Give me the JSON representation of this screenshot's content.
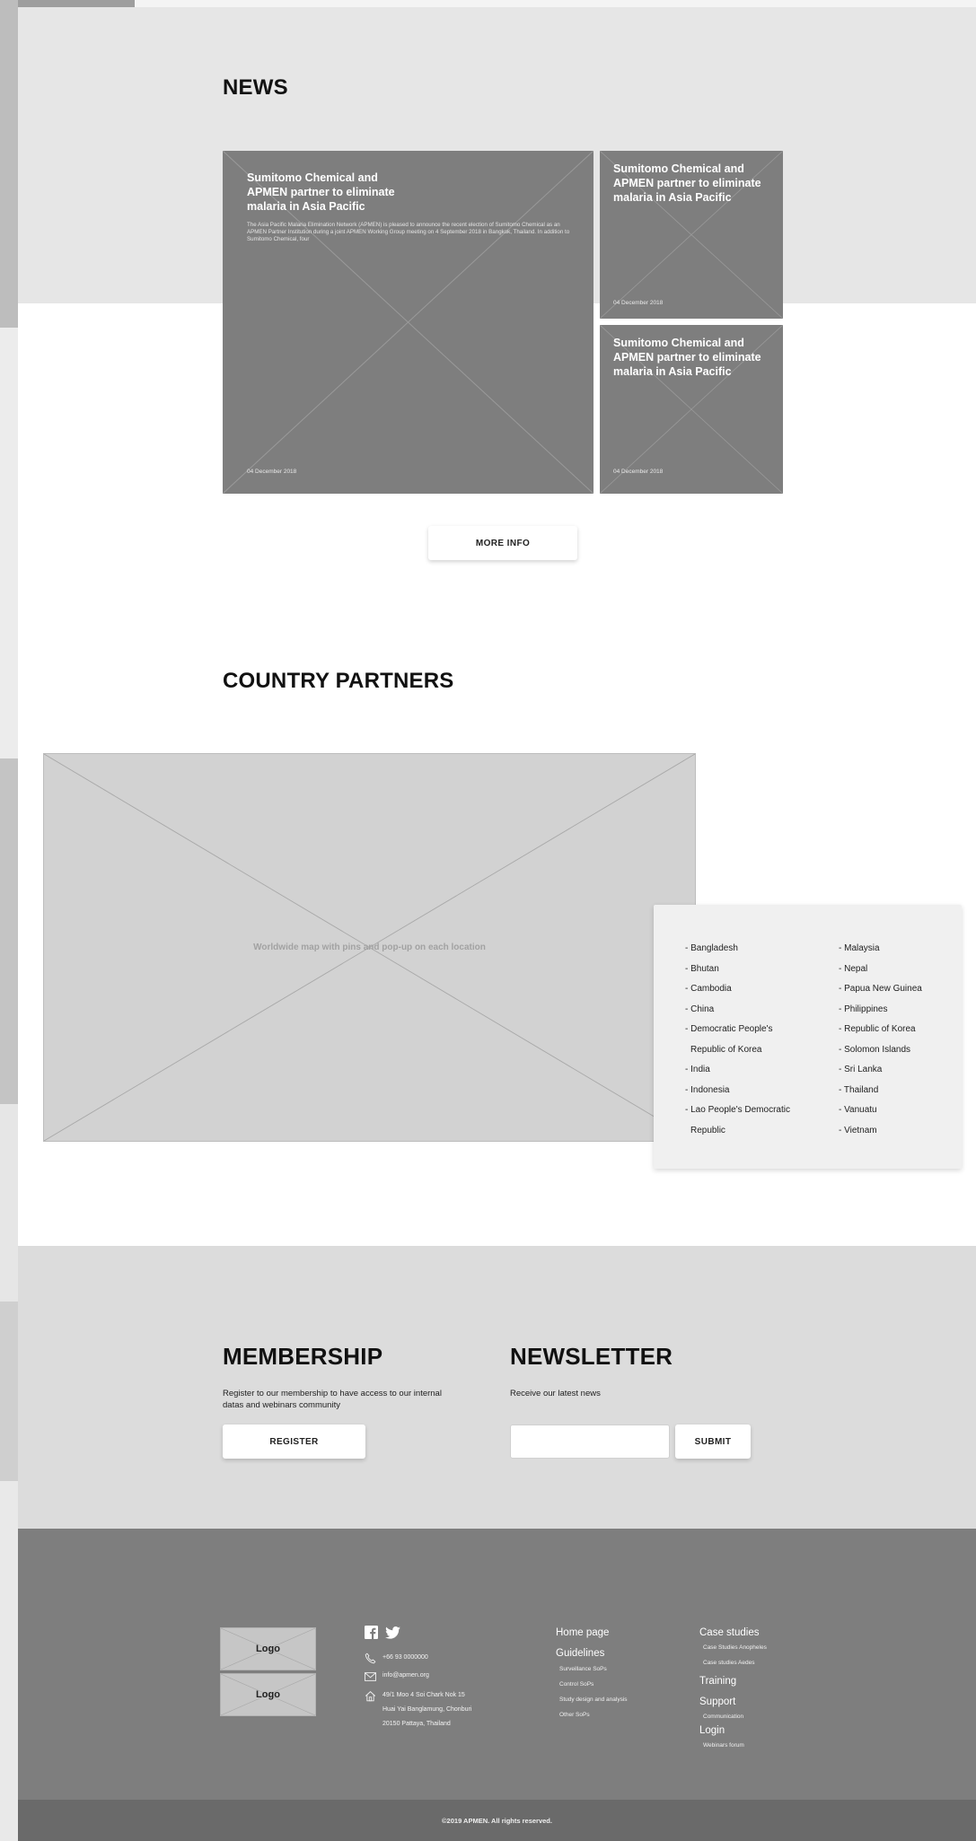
{
  "news": {
    "title": "NEWS",
    "featured": {
      "title": "Sumitomo Chemical and APMEN partner to eliminate malaria in Asia Pacific",
      "excerpt": "The Asia Pacific Malaria Elimination Network (APMEN) is pleased to announce the recent election of Sumitomo Chemical as an APMEN Partner Institution during a joint APMEN Working Group meeting on 4 September 2018 in Bangkok, Thailand. In addition to Sumitomo Chemical, four",
      "date": "04 December 2018"
    },
    "side_cards": [
      {
        "title": "Sumitomo Chemical and APMEN partner to eliminate malaria in Asia Pacific",
        "date": "04 December 2018"
      },
      {
        "title": "Sumitomo Chemical and APMEN partner to eliminate malaria in Asia Pacific",
        "date": "04 December 2018"
      }
    ],
    "more_button": "MORE INFO"
  },
  "partners": {
    "title": "COUNTRY PARTNERS",
    "map_label": "Worldwide map with pins and pop-up on each location",
    "col1": [
      {
        "line1": "- Bangladesh"
      },
      {
        "line1": "- Bhutan"
      },
      {
        "line1": "- Cambodia"
      },
      {
        "line1": "- China"
      },
      {
        "line1": "- Democratic People's",
        "line2": "Republic of Korea"
      },
      {
        "line1": "- India"
      },
      {
        "line1": "- Indonesia"
      },
      {
        "line1": "- Lao People's Democratic",
        "line2": "Republic"
      }
    ],
    "col2": [
      "- Malaysia",
      "- Nepal",
      "- Papua New Guinea",
      "- Philippines",
      "- Republic of Korea",
      "- Solomon Islands",
      "- Sri Lanka",
      "- Thailand",
      "- Vanuatu",
      "- Vietnam"
    ]
  },
  "membership": {
    "title": "MEMBERSHIP",
    "text": "Register to our membership to have access to our internal datas and webinars community",
    "button": "REGISTER"
  },
  "newsletter": {
    "title": "NEWSLETTER",
    "text": "Receive our latest news",
    "input_value": "",
    "button": "SUBMIT"
  },
  "footer": {
    "logo1": "Logo",
    "logo2": "Logo",
    "social_icons": [
      "facebook-icon",
      "twitter-icon"
    ],
    "phone": "+66 93 0000000",
    "email": "info@apmen.org",
    "address": [
      "49/1 Moo 4 Soi Chark Nok 15",
      "Huai Yai Banglamung, Chonburi",
      "20150 Pattaya, Thailand"
    ],
    "nav": {
      "home": "Home page",
      "guidelines": "Guidelines",
      "guidelines_sub": [
        "Surveillance SoPs",
        "Control SoPs",
        "Study design and analysis",
        "Other SoPs"
      ],
      "case_studies": "Case studies",
      "case_sub": [
        "Case Studies Anopheles",
        "Case studies Aedes"
      ],
      "training": "Training",
      "support": "Support",
      "support_sub": [
        "Communication"
      ],
      "login": "Login",
      "login_sub": [
        "Webinars forum"
      ]
    },
    "copyright": "©2019 APMEN. All rights reserved."
  }
}
